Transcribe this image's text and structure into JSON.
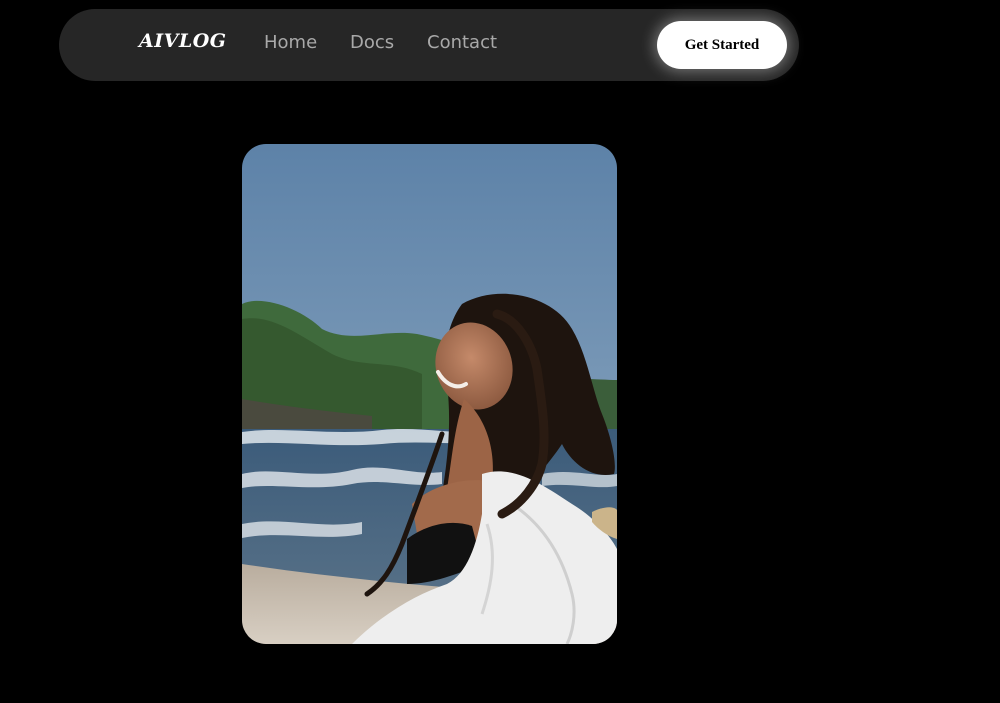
{
  "nav": {
    "logo": "AIVLOG",
    "links": [
      "Home",
      "Docs",
      "Contact"
    ],
    "cta_label": "Get Started"
  },
  "hero": {
    "media": "beach-portrait-image"
  },
  "colors": {
    "background": "#000000",
    "navbar": "#262626",
    "nav_link": "#a9a9a9",
    "cta_bg": "#ffffff",
    "cta_text": "#000000"
  }
}
